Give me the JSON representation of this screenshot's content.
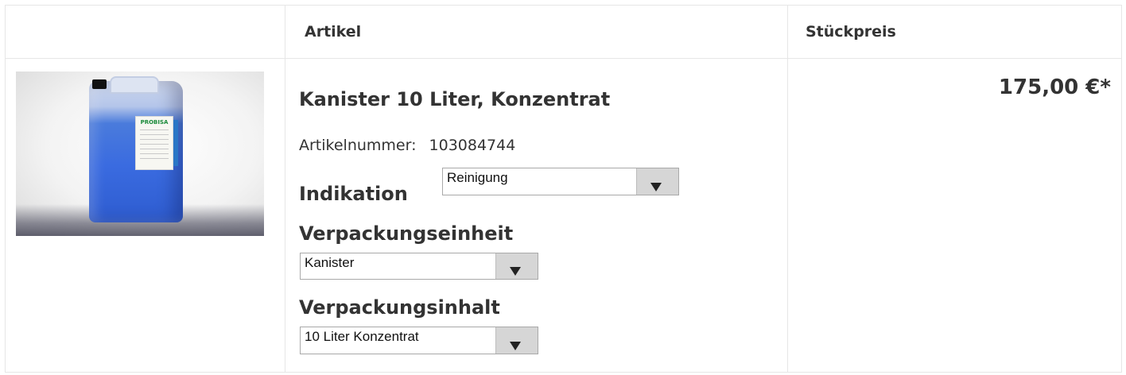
{
  "table": {
    "headers": {
      "artikel": "Artikel",
      "stueckpreis": "Stückpreis"
    }
  },
  "product": {
    "image_brand_text": "PROBISA",
    "title": "Kanister 10 Liter, Konzentrat",
    "artikelnummer_label": "Artikelnummer:",
    "artikelnummer_value": "103084744",
    "price": "175,00 €*"
  },
  "options": {
    "indikation": {
      "label": "Indikation",
      "selected": "Reinigung"
    },
    "verpackungseinheit": {
      "label": "Verpackungseinheit",
      "selected": "Kanister"
    },
    "verpackungsinhalt": {
      "label": "Verpackungsinhalt",
      "selected": "10 Liter Konzentrat"
    }
  },
  "icons": {
    "dropdown": "chevron-down-icon"
  },
  "colors": {
    "border": "#e6e6e6",
    "text": "#333333",
    "select_button": "#d6d6d6"
  }
}
